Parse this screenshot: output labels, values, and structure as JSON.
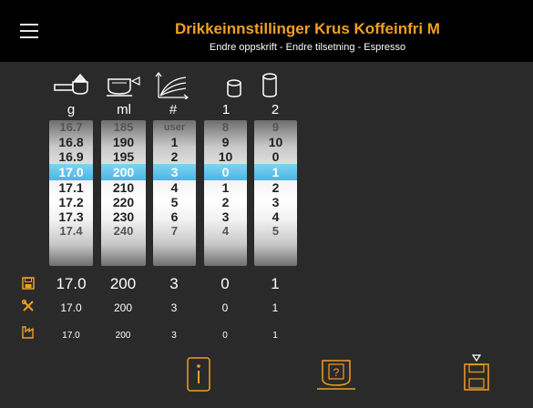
{
  "header": {
    "title": "Drikkeinnstillinger Krus Koffeinfri M",
    "subtitle": "Endre oppskrift - Endre tilsetning - Espresso"
  },
  "columns": [
    {
      "icon": "coffee-scoop-icon",
      "label": "g",
      "items": [
        "16.7",
        "16.8",
        "16.9",
        "17.0",
        "17.1",
        "17.2",
        "17.3",
        "17.4"
      ],
      "selected": 3
    },
    {
      "icon": "cup-volume-icon",
      "label": "ml",
      "items": [
        "185",
        "190",
        "195",
        "200",
        "210",
        "220",
        "230",
        "240"
      ],
      "selected": 3
    },
    {
      "icon": "flow-profile-icon",
      "label": "#",
      "items": [
        "user",
        "1",
        "2",
        "3",
        "4",
        "5",
        "6",
        "7"
      ],
      "selected": 3
    },
    {
      "icon": "container-icon",
      "label": "1",
      "items": [
        "8",
        "9",
        "10",
        "0",
        "1",
        "2",
        "3",
        "4"
      ],
      "selected": 3
    },
    {
      "icon": "container-icon",
      "label": "2",
      "items": [
        "9",
        "10",
        "0",
        "1",
        "2",
        "3",
        "4",
        "5"
      ],
      "selected": 3
    }
  ],
  "rows": {
    "saved": {
      "icon": "save-icon",
      "values": [
        "17.0",
        "200",
        "3",
        "0",
        "1"
      ]
    },
    "service": {
      "icon": "tools-icon",
      "values": [
        "17.0",
        "200",
        "3",
        "0",
        "1"
      ]
    },
    "factory": {
      "icon": "factory-icon",
      "values": [
        "17.0",
        "200",
        "3",
        "0",
        "1"
      ]
    }
  },
  "bottom": {
    "info": "info-button",
    "preview": "cup-help-button",
    "save": "save-button"
  },
  "colors": {
    "accent": "#f0a020",
    "selection": "#4bb6e4",
    "panel": "#2a2a2a"
  }
}
